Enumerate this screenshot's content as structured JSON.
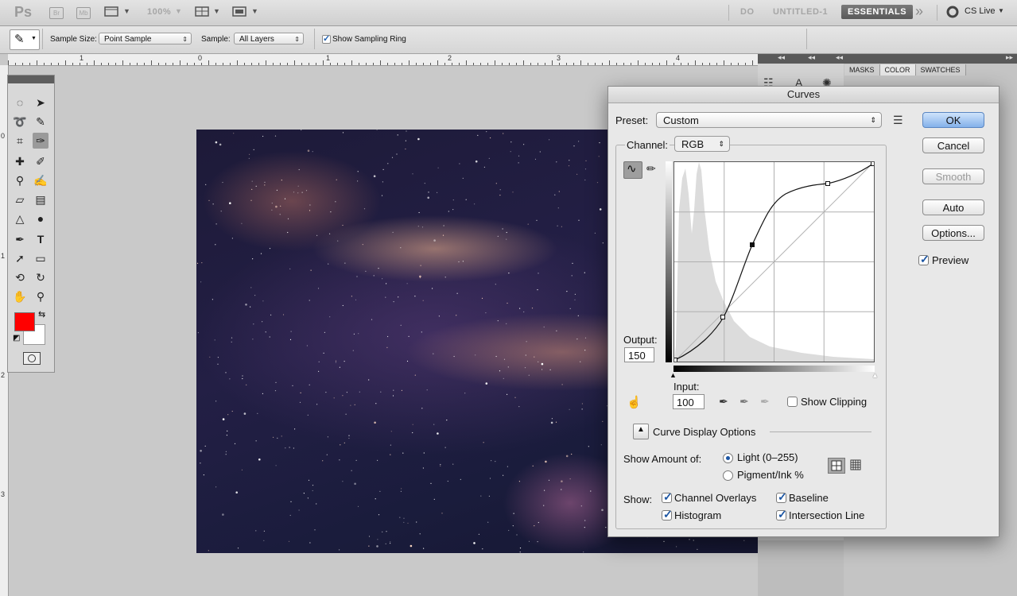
{
  "appbar": {
    "ps_logo": "Ps",
    "br_label": "Br",
    "mb_label": "Mb",
    "zoom": "100%",
    "do_label": "DO",
    "doc_title": "UNTITLED-1",
    "essentials": "ESSENTIALS",
    "more": "»",
    "cs_live": "CS Live"
  },
  "options": {
    "sample_size_label": "Sample Size:",
    "sample_size_value": "Point Sample",
    "sample_label": "Sample:",
    "sample_value": "All Layers",
    "show_ring_label": "Show Sampling Ring",
    "show_ring_checked": true
  },
  "ruler": {
    "top": [
      "1",
      "0",
      "1",
      "2",
      "3",
      "4"
    ],
    "left": [
      "0",
      "1",
      "2",
      "3"
    ]
  },
  "panels": {
    "tabs": [
      "MASKS",
      "COLOR",
      "SWATCHES"
    ],
    "active_tab": "COLOR"
  },
  "colors": {
    "foreground": "#ff0000",
    "background": "#ffffff",
    "accent": "#1b55a3"
  },
  "curves": {
    "title": "Curves",
    "preset_label": "Preset:",
    "preset_value": "Custom",
    "channel_label": "Channel:",
    "channel_value": "RGB",
    "output_label": "Output:",
    "output_value": "150",
    "input_label": "Input:",
    "input_value": "100",
    "show_clipping_label": "Show Clipping",
    "show_clipping_checked": false,
    "ok": "OK",
    "cancel": "Cancel",
    "smooth": "Smooth",
    "auto": "Auto",
    "options": "Options...",
    "preview_label": "Preview",
    "preview_checked": true,
    "display_options_label": "Curve Display Options",
    "show_amount_label": "Show Amount of:",
    "light_label": "Light  (0–255)",
    "light_selected": true,
    "pigment_label": "Pigment/Ink %",
    "show_label": "Show:",
    "channel_overlays_label": "Channel Overlays",
    "histogram_label": "Histogram",
    "baseline_label": "Baseline",
    "intersection_label": "Intersection Line"
  }
}
